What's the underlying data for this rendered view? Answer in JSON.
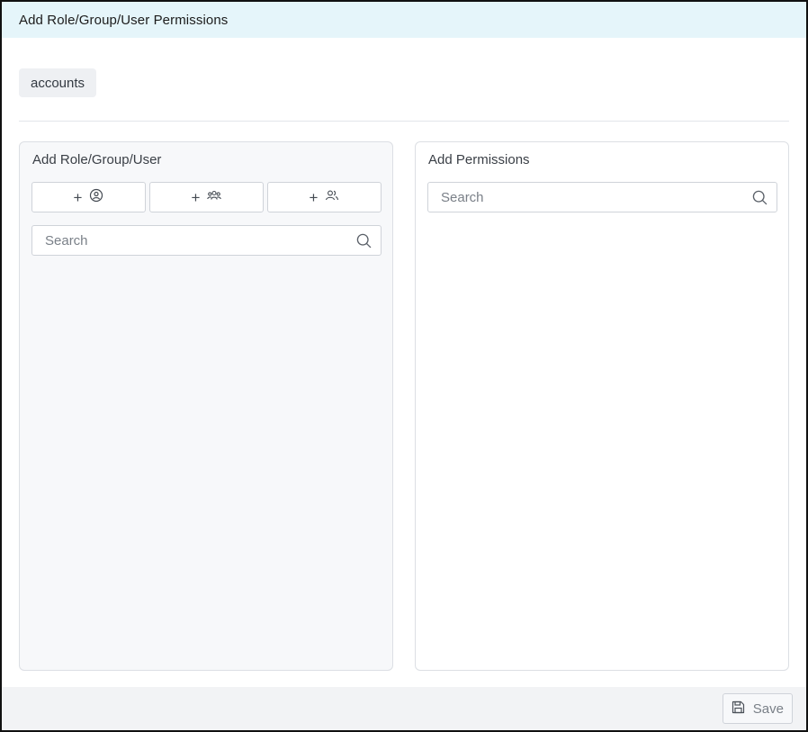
{
  "dialog": {
    "title": "Add Role/Group/User Permissions"
  },
  "tag": {
    "label": "accounts"
  },
  "left_panel": {
    "title": "Add Role/Group/User",
    "buttons": [
      {
        "plus": "+",
        "icon": "role-icon"
      },
      {
        "plus": "+",
        "icon": "group-icon"
      },
      {
        "plus": "+",
        "icon": "user-icon"
      }
    ],
    "search": {
      "value": "",
      "placeholder": "Search",
      "icon": "search-icon"
    }
  },
  "right_panel": {
    "title": "Add Permissions",
    "search": {
      "value": "",
      "placeholder": "Search",
      "icon": "search-icon"
    }
  },
  "footer": {
    "save_label": "Save",
    "save_icon": "save-icon"
  },
  "colors": {
    "header_bg": "#e5f5fa",
    "left_panel_bg": "#f7f8fa",
    "footer_bg": "#f2f3f5",
    "border": "#cfd3d9"
  }
}
